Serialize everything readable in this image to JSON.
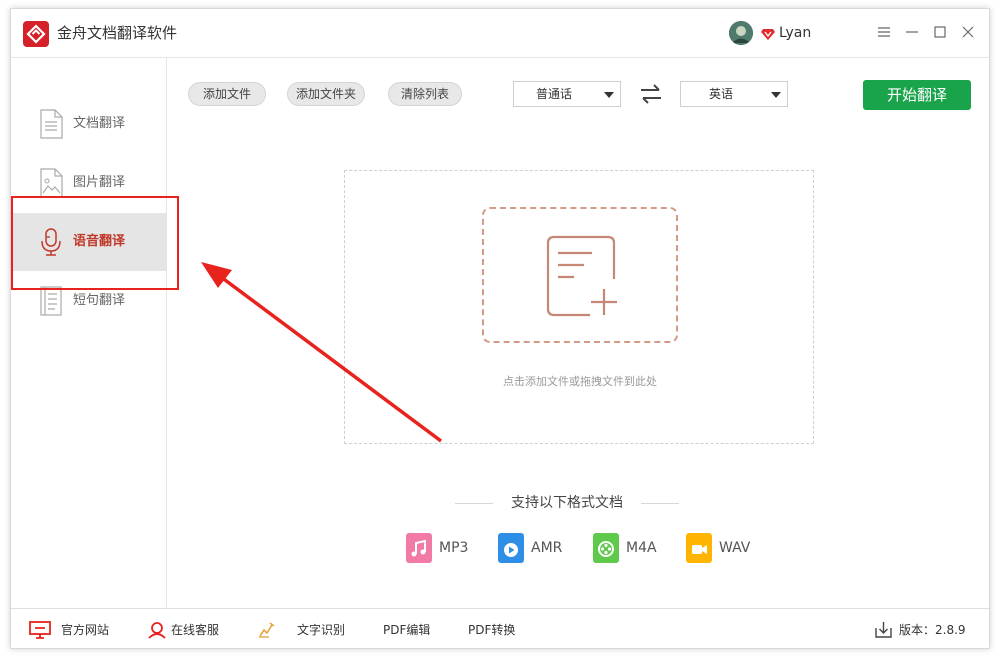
{
  "app": {
    "title": "金舟文档翻译软件"
  },
  "user": {
    "name": "Lyan"
  },
  "sidebar": {
    "items": [
      {
        "label": "文档翻译",
        "icon": "document-icon"
      },
      {
        "label": "图片翻译",
        "icon": "image-icon"
      },
      {
        "label": "语音翻译",
        "icon": "microphone-icon",
        "active": true
      },
      {
        "label": "短句翻译",
        "icon": "sentence-icon"
      }
    ]
  },
  "toolbar": {
    "add_file": "添加文件",
    "add_folder": "添加文件夹",
    "clear_list": "清除列表",
    "source_lang": "普通话",
    "target_lang": "英语",
    "start": "开始翻译"
  },
  "dropzone": {
    "hint": "点击添加文件或拖拽文件到此处"
  },
  "formats": {
    "title": "支持以下格式文档",
    "items": [
      {
        "label": "MP3",
        "color": "#f27aa6"
      },
      {
        "label": "AMR",
        "color": "#2f8fe6"
      },
      {
        "label": "M4A",
        "color": "#5ec94a"
      },
      {
        "label": "WAV",
        "color": "#ffb400"
      }
    ]
  },
  "footer": {
    "website": "官方网站",
    "support": "在线客服",
    "ocr": "文字识别",
    "pdf_edit": "PDF编辑",
    "pdf_convert": "PDF转换",
    "version": "版本：2.8.9"
  },
  "colors": {
    "accent_red": "#e8221c",
    "start_green": "#19a34a",
    "brand_red": "#d4212a"
  }
}
